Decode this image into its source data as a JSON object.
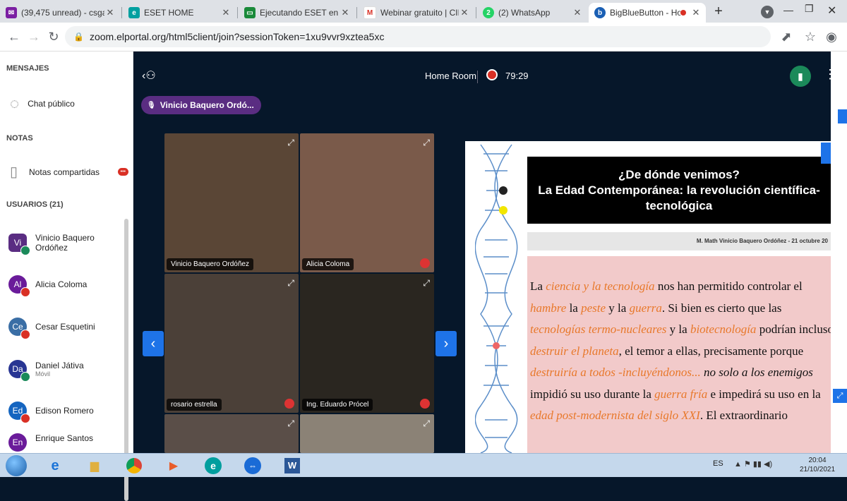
{
  "browser": {
    "tabs": [
      {
        "title": "(39,475 unread) - csga8",
        "icon": "mail-icon",
        "color": "#7b1fa2",
        "active": false
      },
      {
        "title": "ESET HOME",
        "icon": "eset-icon",
        "color": "#00a0a0",
        "active": false
      },
      {
        "title": "Ejecutando ESET en Wi",
        "icon": "eset-run-icon",
        "color": "#1a8a3a",
        "active": false
      },
      {
        "title": "Webinar gratuito | CIEN",
        "icon": "gmail-icon",
        "color": "#d93025",
        "active": false
      },
      {
        "title": "(2) WhatsApp",
        "icon": "whatsapp-icon",
        "color": "#25d366",
        "active": false
      },
      {
        "title": "BigBlueButton - Ho",
        "icon": "bbb-icon",
        "color": "#1a5fb4",
        "active": true
      }
    ],
    "url": "zoom.elportal.org/html5client/join?sessionToken=1xu9vvr9xztea5xc"
  },
  "sidebar": {
    "messages_header": "MENSAJES",
    "public_chat": "Chat público",
    "notes_header": "NOTAS",
    "shared_notes": "Notas compartidas",
    "notes_badge": "•••",
    "users_header": "USUARIOS (21)",
    "users": [
      {
        "initials": "Vi",
        "name": "Vinicio Baquero Ordóñez",
        "sub": "",
        "color": "#5a2d82",
        "mic": "#1b8a5a"
      },
      {
        "initials": "Al",
        "name": "Alicia Coloma",
        "sub": "",
        "color": "#6a1b9a",
        "mic": "#d93025"
      },
      {
        "initials": "Ce",
        "name": "Cesar Esquetini",
        "sub": "",
        "color": "#3a6ea5",
        "mic": "#d93025"
      },
      {
        "initials": "Da",
        "name": "Daniel Játiva",
        "sub": "Móvil",
        "color": "#283593",
        "mic": "#1b8a5a"
      },
      {
        "initials": "Ed",
        "name": "Edison Romero",
        "sub": "",
        "color": "#1565c0",
        "mic": "#d93025"
      },
      {
        "initials": "En",
        "name": "Enrique Santos",
        "sub": "",
        "color": "#6a1b9a",
        "mic": "#d93025"
      }
    ]
  },
  "meeting": {
    "room": "Home Room",
    "timer": "79:29",
    "speaker": "Vinicio Baquero Ordó...",
    "tiles": [
      {
        "label": "Vinicio Baquero Ordóñez",
        "bg": "#5a4636"
      },
      {
        "label": "Alicia Coloma",
        "bg": "#7a5a4a"
      },
      {
        "label": "rosario estrella",
        "bg": "#4b4038"
      },
      {
        "label": "Ing. Eduardo Prócel",
        "bg": "#2a2620"
      },
      {
        "label": "",
        "bg": "#5a4e48"
      },
      {
        "label": "",
        "bg": "#8b8276"
      }
    ]
  },
  "slide": {
    "title1": "¿De dónde venimos?",
    "title2": "La Edad Contemporánea: la revolución científica-",
    "title3": "tecnológica",
    "author": "M. Math Vinicio Baquero Ordóñez - 21 octubre 20"
  },
  "taskbar": {
    "lang": "ES",
    "time": "20:04",
    "date": "21/10/2021"
  }
}
